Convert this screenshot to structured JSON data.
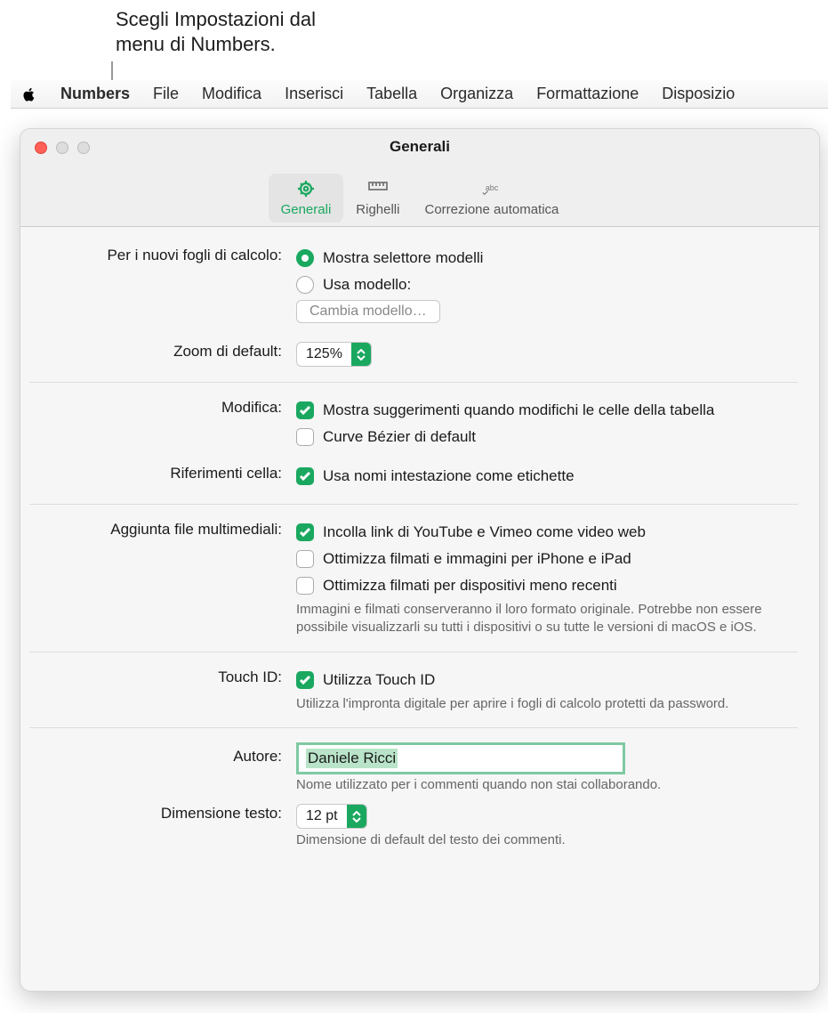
{
  "callout": "Scegli Impostazioni dal\nmenu di Numbers.",
  "menubar": [
    "Numbers",
    "File",
    "Modifica",
    "Inserisci",
    "Tabella",
    "Organizza",
    "Formattazione",
    "Disposizio"
  ],
  "window_title": "Generali",
  "toolbar": {
    "general": "Generali",
    "rulers": "Righelli",
    "autocorrect": "Correzione automatica"
  },
  "new_spreadsheets": {
    "label": "Per i nuovi fogli di calcolo:",
    "opt_show_chooser": "Mostra selettore modelli",
    "opt_use_template": "Usa modello:",
    "change_template_btn": "Cambia modello…"
  },
  "default_zoom": {
    "label": "Zoom di default:",
    "value": "125%"
  },
  "editing": {
    "label": "Modifica:",
    "show_suggestions": "Mostra suggerimenti quando modifichi le celle della tabella",
    "bezier_default": "Curve Bézier di default"
  },
  "cell_refs": {
    "label": "Riferimenti cella:",
    "use_header_names": "Usa nomi intestazione come etichette"
  },
  "media": {
    "label": "Aggiunta file multimediali:",
    "paste_links": "Incolla link di YouTube e Vimeo come video web",
    "opt_iphone": "Ottimizza filmati e immagini per iPhone e iPad",
    "opt_older": "Ottimizza filmati per dispositivi meno recenti",
    "desc": "Immagini e filmati conserveranno il loro formato originale. Potrebbe non essere possibile visualizzarli su tutti i dispositivi o su tutte le versioni di macOS e iOS."
  },
  "touchid": {
    "label": "Touch ID:",
    "use": "Utilizza Touch ID",
    "desc": "Utilizza l'impronta digitale per aprire i fogli di calcolo protetti da password."
  },
  "author": {
    "label": "Autore:",
    "value": "Daniele Ricci",
    "desc": "Nome utilizzato per i commenti quando non stai collaborando."
  },
  "textsize": {
    "label": "Dimensione testo:",
    "value": "12 pt",
    "desc": "Dimensione di default del testo dei commenti."
  }
}
